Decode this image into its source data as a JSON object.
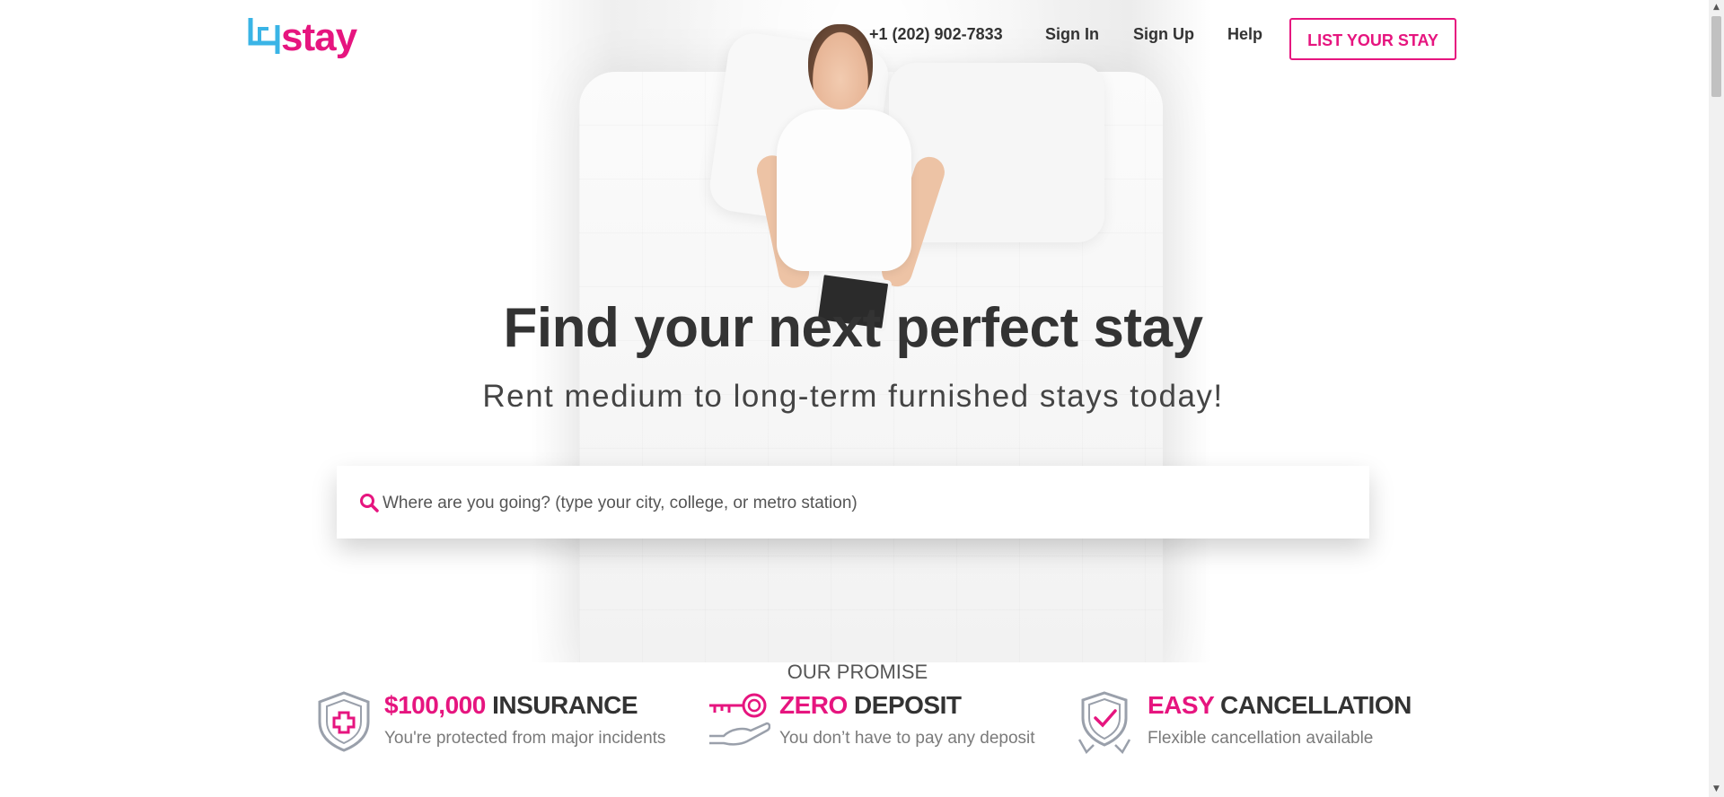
{
  "header": {
    "logo_text": "stay",
    "phone": "+1 (202) 902-7833",
    "sign_in": "Sign In",
    "sign_up": "Sign Up",
    "help": "Help",
    "list_your_stay": "LIST YOUR STAY"
  },
  "hero": {
    "title": "Find your next perfect stay",
    "subtitle": "Rent medium to long-term furnished stays today!"
  },
  "search": {
    "placeholder": "Where are you going? (type your city, college, or metro station)",
    "icon": "search-icon"
  },
  "promise": {
    "heading": "OUR PROMISE",
    "items": [
      {
        "accent": "$100,000",
        "title": " INSURANCE",
        "subtitle": "You're protected from major incidents",
        "icon": "shield-plus-icon"
      },
      {
        "accent": "ZERO",
        "title": " DEPOSIT",
        "subtitle": "You don’t have to pay any deposit",
        "icon": "key-hand-icon"
      },
      {
        "accent": "EASY",
        "title": " CANCELLATION",
        "subtitle": "Flexible cancellation available",
        "icon": "check-badge-icon"
      }
    ]
  },
  "colors": {
    "brand_pink": "#e6157f",
    "brand_blue": "#3ab4e6",
    "text_dark": "#333333",
    "text_muted": "#7a7a7a"
  }
}
